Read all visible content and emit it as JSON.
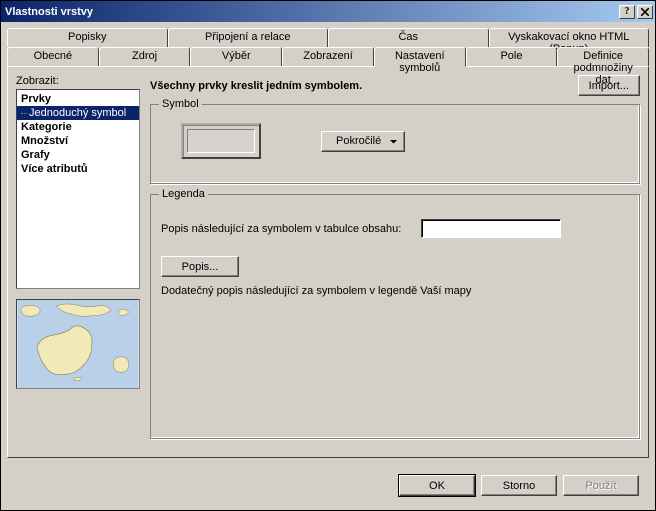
{
  "title": "Vlastnosti vrstvy",
  "tabs_row1": [
    "Popisky",
    "Připojení a relace",
    "Čas",
    "Vyskakovací okno HTML (Popup)"
  ],
  "tabs_row2": [
    "Obecné",
    "Zdroj",
    "Výběr",
    "Zobrazení",
    "Nastavení symbolů",
    "Pole",
    "Definice podmnožiny dat"
  ],
  "active_tab": "Nastavení symbolů",
  "left": {
    "label": "Zobrazit:",
    "tree": {
      "prvky": "Prvky",
      "jednoduchy": "Jednoduchý symbol",
      "kategorie": "Kategorie",
      "mnozstvi": "Množství",
      "grafy": "Grafy",
      "vice": "Více atributů"
    }
  },
  "main": {
    "heading": "Všechny prvky kreslit jedním symbolem.",
    "import_btn": "Import...",
    "symbol_legend": "Symbol",
    "advanced_btn": "Pokročilé",
    "legend_legend": "Legenda",
    "legend_label": "Popis následující za symbolem v tabulce obsahu:",
    "legend_value": "",
    "popis_btn": "Popis...",
    "legend_desc": "Dodatečný popis následující za symbolem v legendě Vaší mapy"
  },
  "footer": {
    "ok": "OK",
    "storno": "Storno",
    "pouzit": "Použít"
  }
}
